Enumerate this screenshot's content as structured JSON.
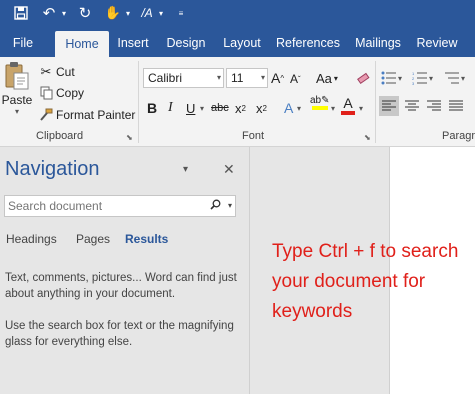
{
  "quick_access": {
    "icons": [
      "save-icon",
      "undo-icon",
      "redo-icon",
      "touch-mode-icon",
      "format-icon",
      "customize-icon"
    ]
  },
  "ribbon_tabs": [
    {
      "label": "File"
    },
    {
      "label": "Home"
    },
    {
      "label": "Insert"
    },
    {
      "label": "Design"
    },
    {
      "label": "Layout"
    },
    {
      "label": "References"
    },
    {
      "label": "Mailings"
    },
    {
      "label": "Review"
    }
  ],
  "active_tab": "Home",
  "clipboard": {
    "paste_label": "Paste",
    "cut_label": "Cut",
    "copy_label": "Copy",
    "format_painter_label": "Format Painter",
    "group_label": "Clipboard"
  },
  "font": {
    "font_name": "Calibri",
    "font_size": "11",
    "change_case_label": "Aa",
    "group_label": "Font"
  },
  "paragraph": {
    "group_label": "Paragra"
  },
  "navigation": {
    "title": "Navigation",
    "search_placeholder": "Search document",
    "tabs": [
      {
        "label": "Headings"
      },
      {
        "label": "Pages"
      },
      {
        "label": "Results"
      }
    ],
    "active_tab": "Results",
    "help_text_1": "Text, comments, pictures... Word can find just about anything in your document.",
    "help_text_2": "Use the search box for text or the magnifying glass for everything else."
  },
  "annotation": {
    "text": "Type Ctrl + f to search your document for keywords",
    "color": "#e0201a"
  },
  "colors": {
    "brand": "#2b579a",
    "ribbon_bg": "#f3f3f3",
    "pane_bg": "#e6e6e6",
    "highlight_yellow": "#ffff00",
    "font_color_red": "#e0201a"
  }
}
